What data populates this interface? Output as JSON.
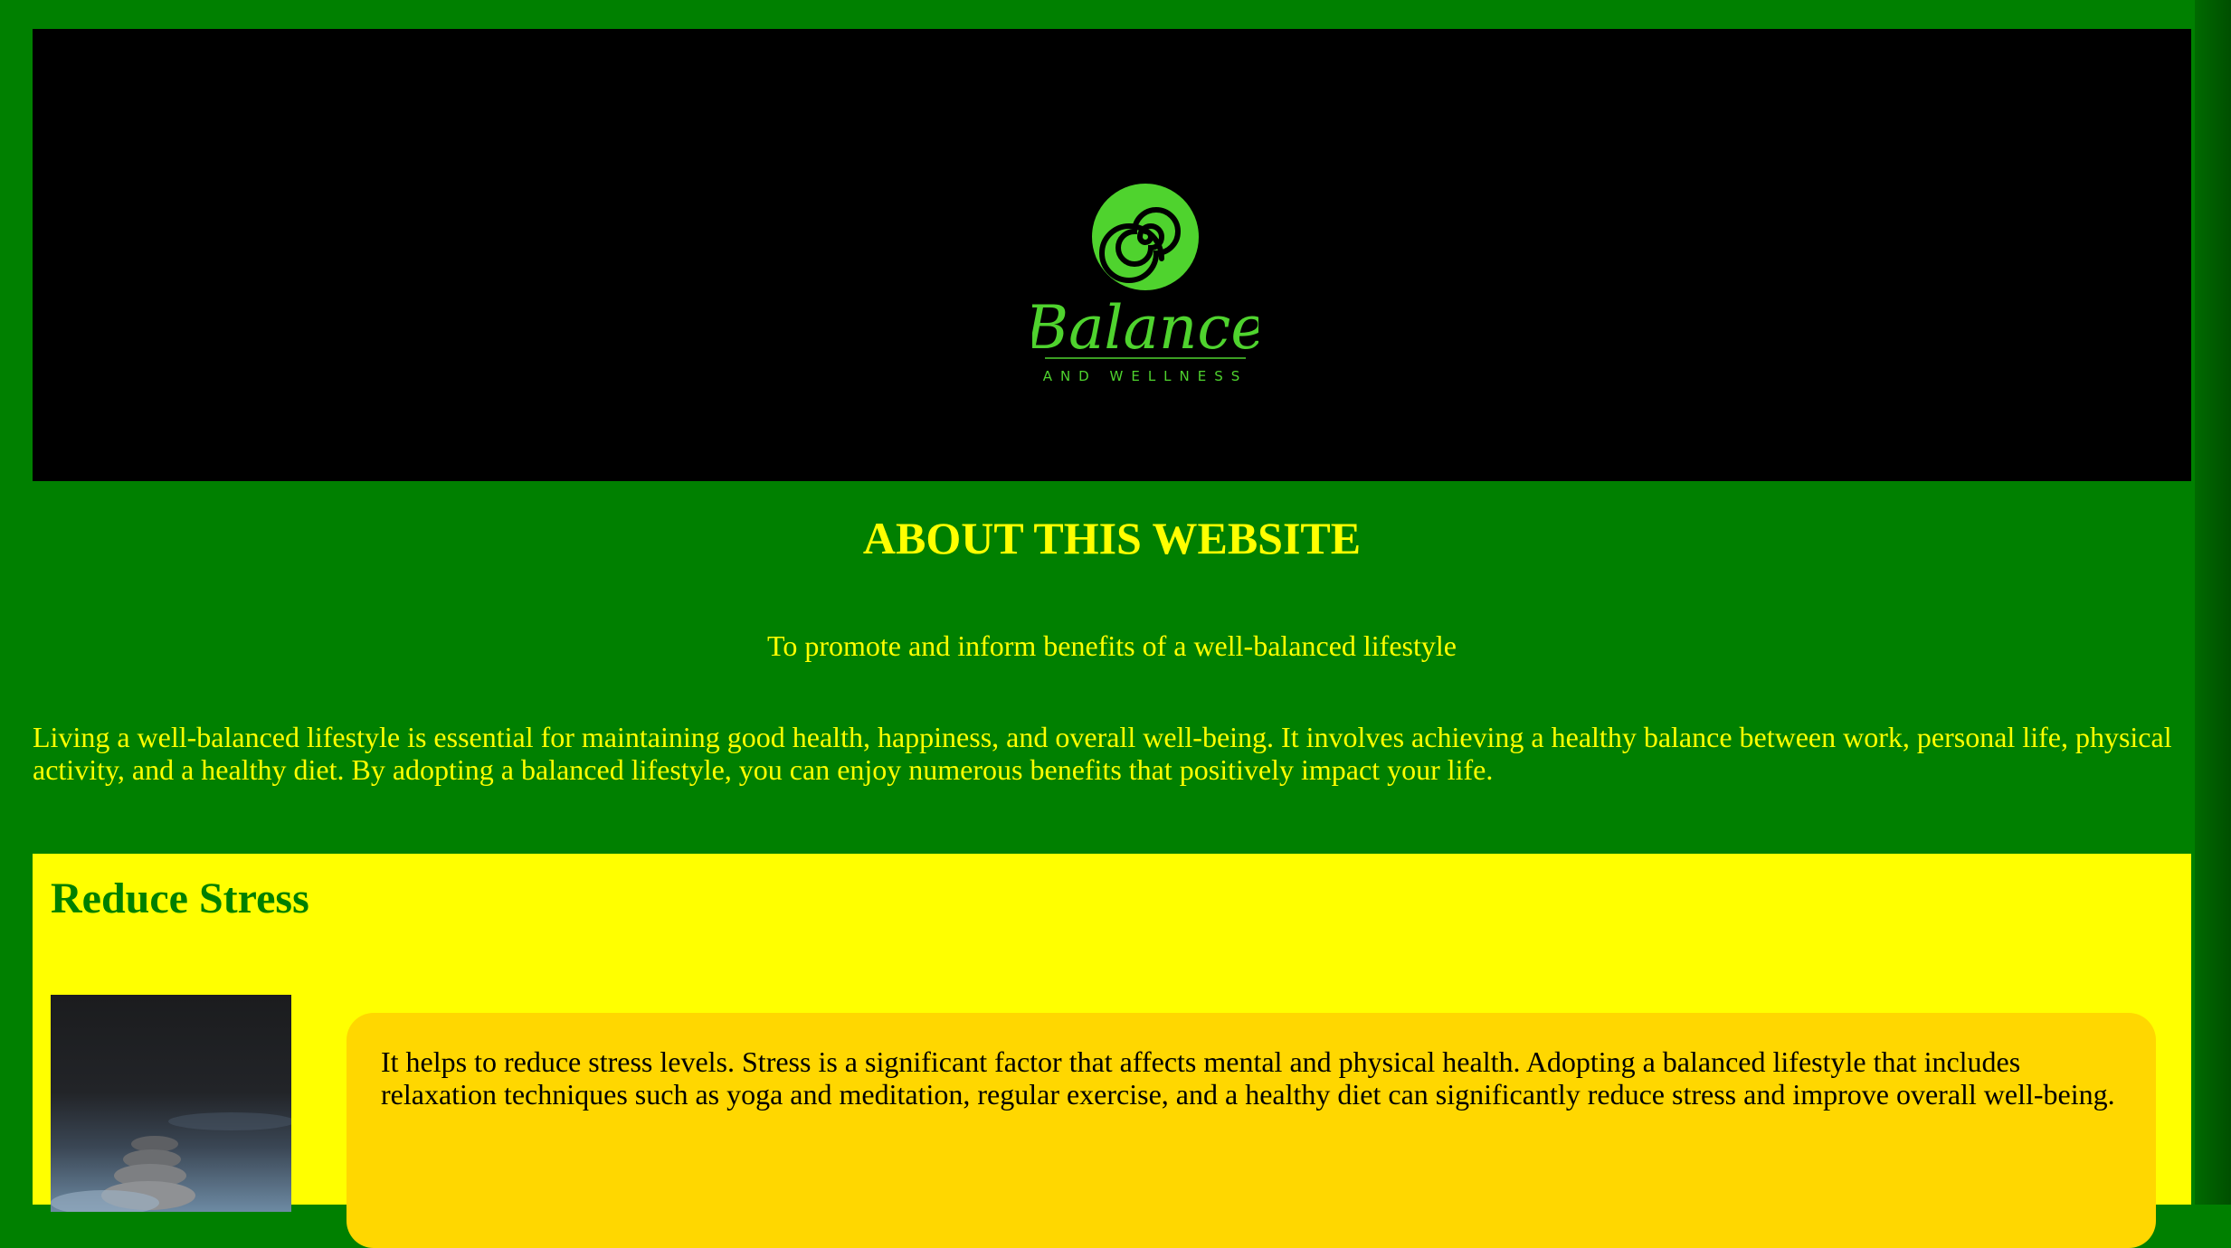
{
  "banner": {
    "logo": {
      "icon": "spiral-icon",
      "brand_name": "Balance",
      "tagline": "AND WELLNESS",
      "color": "#4fd32e"
    },
    "background": "#000000"
  },
  "about": {
    "title": "ABOUT THIS WEBSITE",
    "subtitle": "To promote and inform benefits of a well-balanced lifestyle",
    "intro": "Living a well-balanced lifestyle is essential for maintaining good health, happiness, and overall well-being. It involves achieving a healthy balance between work, personal life, physical activity, and a healthy diet. By adopting a balanced lifestyle, you can enjoy numerous benefits that positively impact your life."
  },
  "sections": [
    {
      "title": "Reduce Stress",
      "image": "stacked-stones-image",
      "text": "It helps to reduce stress levels. Stress is a significant factor that affects mental and physical health. Adopting a balanced lifestyle that includes relaxation techniques such as yoga and meditation, regular exercise, and a healthy diet can significantly reduce stress and improve overall well-being."
    }
  ],
  "colors": {
    "page_background": "#008000",
    "heading_text": "#ffff00",
    "section_background": "#ffff00",
    "section_title": "#008000",
    "card_background": "#ffd700"
  }
}
